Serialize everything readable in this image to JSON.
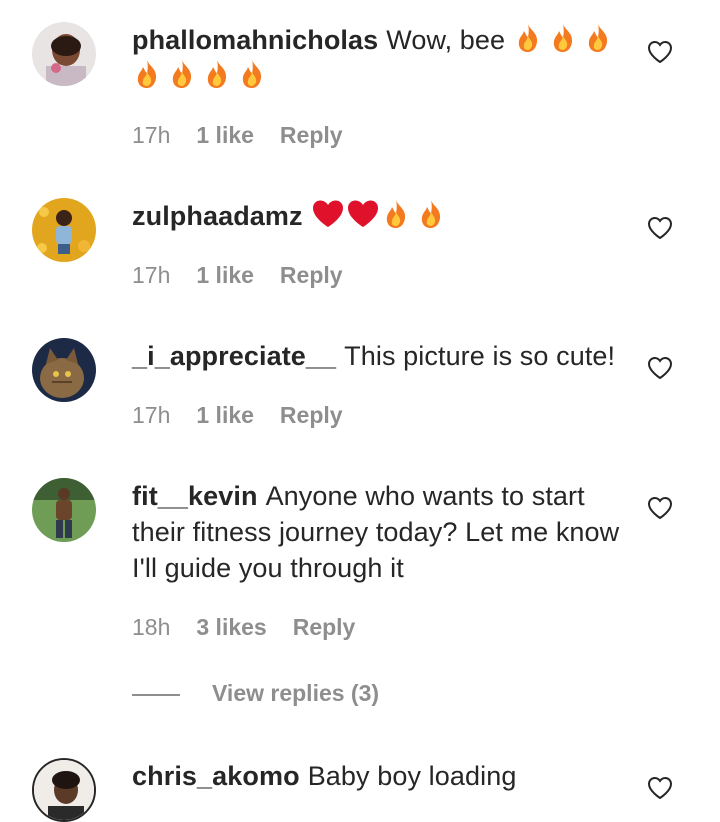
{
  "colors": {
    "text": "#262626",
    "secondary": "#8e8e8e",
    "fire": "#f5a623",
    "heart": "#e0112b"
  },
  "comments": [
    {
      "username": "phallomahnicholas",
      "text": "Wow, bee",
      "emoji": [
        "fire-icon",
        "fire-icon",
        "fire-icon",
        "fire-icon",
        "fire-icon",
        "fire-icon",
        "fire-icon"
      ],
      "time": "17h",
      "likes": "1 like",
      "reply": "Reply"
    },
    {
      "username": "zulphaadamz",
      "text": "",
      "emoji": [
        "red-heart-icon",
        "red-heart-icon",
        "fire-icon",
        "fire-icon"
      ],
      "time": "17h",
      "likes": "1 like",
      "reply": "Reply"
    },
    {
      "username": "_i_appreciate__",
      "text": "This picture is so cute!",
      "emoji": [],
      "time": "17h",
      "likes": "1 like",
      "reply": "Reply"
    },
    {
      "username": "fit__kevin",
      "text": "Anyone who wants to start their fitness journey today? Let me know I'll guide you through it",
      "emoji": [],
      "time": "18h",
      "likes": "3 likes",
      "reply": "Reply",
      "view_replies": "View replies (3)"
    },
    {
      "username": "chris_akomo",
      "text": "Baby boy loading",
      "emoji": []
    }
  ]
}
